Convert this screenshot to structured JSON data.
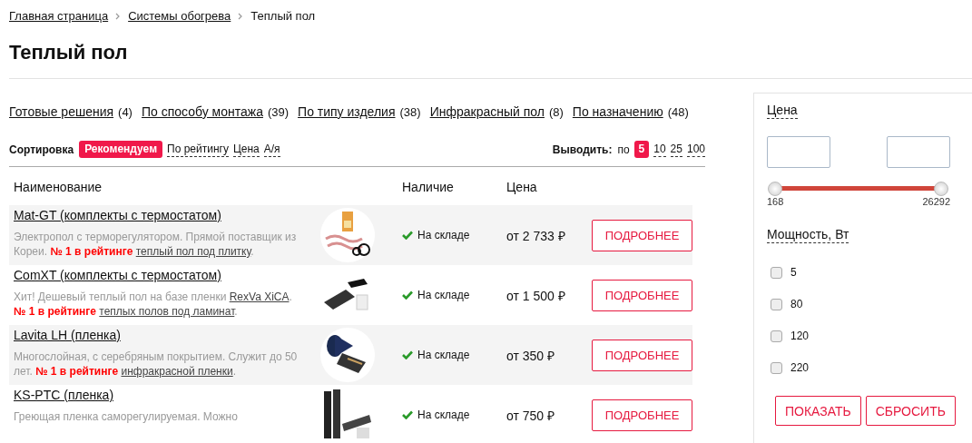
{
  "breadcrumbs": [
    {
      "label": "Главная страница",
      "kind": "link"
    },
    {
      "label": "Системы обогрева",
      "kind": "link"
    },
    {
      "label": "Теплый пол",
      "kind": "current"
    }
  ],
  "title": "Теплый пол",
  "categories": [
    {
      "label": "Готовые решения",
      "count": "(4)"
    },
    {
      "label": "По способу монтажа",
      "count": "(39)"
    },
    {
      "label": "По типу изделия",
      "count": "(38)"
    },
    {
      "label": "Инфракрасный пол",
      "count": "(8)"
    },
    {
      "label": "По назначению",
      "count": "(48)"
    }
  ],
  "sort": {
    "label": "Сортировка",
    "options": [
      {
        "label": "Рекомендуем",
        "selected": true
      },
      {
        "label": "По рейтингу",
        "selected": false
      },
      {
        "label": "Цена",
        "selected": false
      },
      {
        "label": "А/я",
        "selected": false
      }
    ]
  },
  "per_page": {
    "label": "Выводить:",
    "prefix": "по",
    "options": [
      {
        "label": "5",
        "selected": true
      },
      {
        "label": "10",
        "selected": false
      },
      {
        "label": "25",
        "selected": false
      },
      {
        "label": "100",
        "selected": false
      }
    ]
  },
  "table": {
    "columns": [
      "Наименование",
      "Наличие",
      "Цена"
    ],
    "rows": [
      {
        "name": "Mat-GT (комплекты с термостатом)",
        "description": [
          {
            "kind": "text",
            "text": "Электропол с терморегулятором. Прямой поставщик из Кореи. "
          },
          {
            "kind": "highlight",
            "text": "№ 1 в рейтинге"
          },
          {
            "kind": "link",
            "text": "теплый пол под плитку"
          },
          {
            "kind": "text",
            "text": "."
          }
        ],
        "stock": "На складе",
        "price": "от 2 733 ₽",
        "button": "ПОДРОБНЕЕ"
      },
      {
        "name": "ComXT (комплекты с термостатом)",
        "description": [
          {
            "kind": "text",
            "text": "Хит! Дешевый теплый пол на базе пленки "
          },
          {
            "kind": "link",
            "text": "RexVa XiCA"
          },
          {
            "kind": "text",
            "text": ". "
          },
          {
            "kind": "highlight",
            "text": "№ 1 в рейтинге"
          },
          {
            "kind": "link",
            "text": "теплых полов под ламинат"
          },
          {
            "kind": "text",
            "text": "."
          }
        ],
        "stock": "На складе",
        "price": "от 1 500 ₽",
        "button": "ПОДРОБНЕЕ"
      },
      {
        "name": "Lavita LH (пленка)",
        "description": [
          {
            "kind": "text",
            "text": "Многослойная, с серебряным покрытием. Служит до 50 лет. "
          },
          {
            "kind": "highlight",
            "text": "№ 1 в рейтинге"
          },
          {
            "kind": "link",
            "text": "инфракрасной пленки"
          },
          {
            "kind": "text",
            "text": "."
          }
        ],
        "stock": "На складе",
        "price": "от 350 ₽",
        "button": "ПОДРОБНЕЕ"
      },
      {
        "name": "KS-PTC (пленка)",
        "description": [
          {
            "kind": "text",
            "text": "Греющая пленка саморегулируемая. Можно"
          }
        ],
        "stock": "На складе",
        "price": "от 750 ₽",
        "button": "ПОДРОБНЕЕ"
      }
    ]
  },
  "filter": {
    "price": {
      "label": "Цена",
      "min": "168",
      "max": "26292",
      "thumbs": [
        {
          "level": 0
        },
        {
          "level": 1
        }
      ]
    },
    "power": {
      "label": "Мощность, Вт",
      "options": [
        {
          "label": "5",
          "checked": false
        },
        {
          "label": "80",
          "checked": false
        },
        {
          "label": "120",
          "checked": false
        },
        {
          "label": "220",
          "checked": false
        }
      ]
    },
    "buttons": [
      "ПОКАЗАТЬ",
      "СБРОСИТЬ"
    ]
  }
}
